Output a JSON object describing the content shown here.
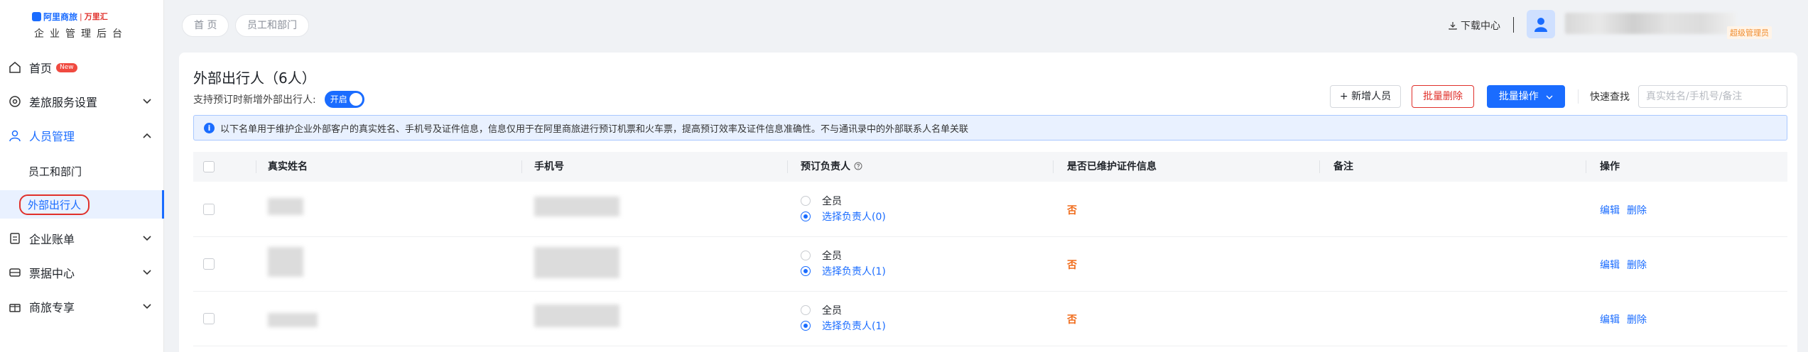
{
  "logo": {
    "brand": "阿里商旅",
    "separator": "|",
    "sub": "万里汇",
    "title": "企业管理后台"
  },
  "nav": {
    "items": [
      {
        "label": "首页",
        "badge": "New"
      },
      {
        "label": "差旅服务设置"
      },
      {
        "label": "人员管理"
      },
      {
        "label": "企业账单"
      },
      {
        "label": "票据中心"
      },
      {
        "label": "商旅专享"
      }
    ],
    "sub_items": [
      {
        "label": "员工和部门"
      },
      {
        "label": "外部出行人"
      }
    ]
  },
  "breadcrumb": [
    "首 页",
    "员工和部门"
  ],
  "topbar": {
    "download": "下载中心",
    "separator": "|",
    "role": "超级管理员"
  },
  "page": {
    "title": "外部出行人（6人）",
    "toggle_label": "支持预订时新增外部出行人:",
    "toggle_state": "开启"
  },
  "toolbar": {
    "add": "+ 新增人员",
    "batch_delete": "批量删除",
    "batch_ops": "批量操作",
    "quick_search_label": "快速查找",
    "quick_search_placeholder": "真实姓名/手机号/备注"
  },
  "notice": "以下名单用于维护企业外部客户的真实姓名、手机号及证件信息，信息仅用于在阿里商旅进行预订机票和火车票，提高预订效率及证件信息准确性。不与通讯录中的外部联系人名单关联",
  "table": {
    "headers": [
      "真实姓名",
      "手机号",
      "预订负责人",
      "是否已维护证件信息",
      "备注",
      "操作"
    ],
    "rows": [
      {
        "opt_all": "全员",
        "opt_select": "选择负责人(0)",
        "cert": "否",
        "edit": "编辑",
        "delete": "删除"
      },
      {
        "opt_all": "全员",
        "opt_select": "选择负责人(1)",
        "cert": "否",
        "edit": "编辑",
        "delete": "删除"
      },
      {
        "opt_all": "全员",
        "opt_select": "选择负责人(1)",
        "cert": "否",
        "edit": "编辑",
        "delete": "删除"
      }
    ]
  },
  "colors": {
    "accent": "#1a6cff",
    "danger": "#e0302b",
    "warning": "#f06b1a"
  }
}
